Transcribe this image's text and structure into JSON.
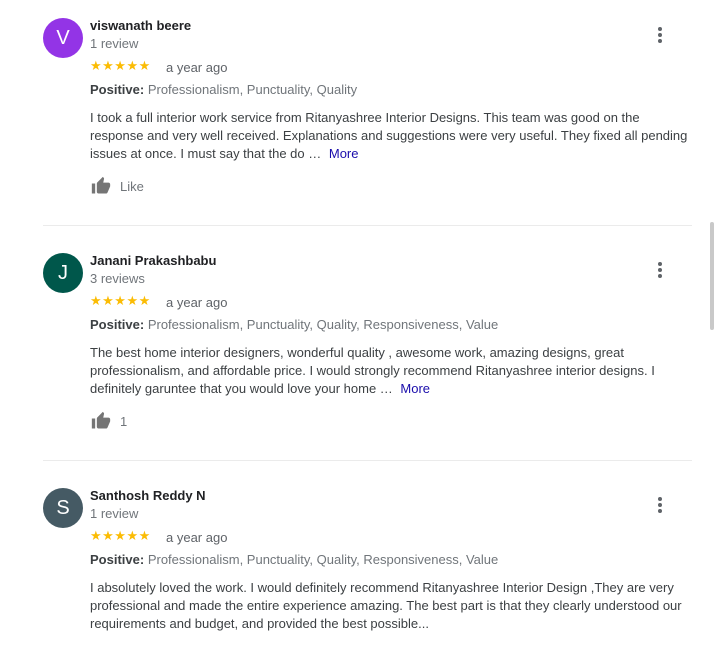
{
  "reviews": [
    {
      "avatar_letter": "V",
      "avatar_color": "#9334e6",
      "name": "viswanath beere",
      "count": "1 review",
      "stars": "★★★★★",
      "date": "a year ago",
      "positive_label": "Positive:",
      "positive_values": "Professionalism, Punctuality, Quality",
      "text": "I took a full interior work service from Ritanyashree Interior Designs. This team was good on the response and very well received. Explanations and suggestions were very useful. They fixed all pending issues at once. I must say that the do …",
      "more": "More",
      "action_label": "Like"
    },
    {
      "avatar_letter": "J",
      "avatar_color": "#00574b",
      "name": "Janani Prakashbabu",
      "count": "3 reviews",
      "stars": "★★★★★",
      "date": "a year ago",
      "positive_label": "Positive:",
      "positive_values": "Professionalism, Punctuality, Quality, Responsiveness, Value",
      "text": "The best home interior designers, wonderful quality , awesome work, amazing designs, great professionalism, and affordable price. I would strongly recommend Ritanyashree interior designs. I definitely garuntee that you would love your home …",
      "more": "More",
      "action_label": "1"
    },
    {
      "avatar_letter": "S",
      "avatar_color": "#455a64",
      "name": "Santhosh Reddy N",
      "count": "1 review",
      "stars": "★★★★★",
      "date": "a year ago",
      "positive_label": "Positive:",
      "positive_values": "Professionalism, Punctuality, Quality, Responsiveness, Value",
      "text": "I absolutely loved the work. I would definitely recommend Ritanyashree Interior Design ,They are very professional and made the entire experience amazing. The best part is that they clearly understood our requirements and budget, and provided the best possible..."
    }
  ]
}
